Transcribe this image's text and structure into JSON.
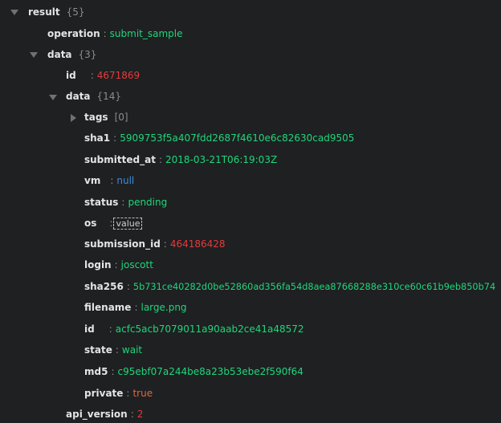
{
  "result": {
    "key": "result",
    "count": "{5}",
    "operation": {
      "key": "operation",
      "value": "submit_sample"
    },
    "data": {
      "key": "data",
      "count": "{3}",
      "id": {
        "key": "id",
        "value": "4671869"
      },
      "data": {
        "key": "data",
        "count": "{14}",
        "tags": {
          "key": "tags",
          "count": "[0]"
        },
        "sha1": {
          "key": "sha1",
          "value": "5909753f5a407fdd2687f4610e6c82630cad9505"
        },
        "submitted_at": {
          "key": "submitted_at",
          "value": "2018-03-21T06:19:03Z"
        },
        "vm": {
          "key": "vm",
          "value": "null"
        },
        "status": {
          "key": "status",
          "value": "pending"
        },
        "os": {
          "key": "os",
          "value": "value"
        },
        "submission_id": {
          "key": "submission_id",
          "value": "464186428"
        },
        "login": {
          "key": "login",
          "value": "joscott"
        },
        "sha256": {
          "key": "sha256",
          "value": "5b731ce40282d0be52860ad356fa54d8aea87668288e310ce60c61b9eb850b74"
        },
        "filename": {
          "key": "filename",
          "value": "large.png"
        },
        "id": {
          "key": "id",
          "value": "acfc5acb7079011a90aab2ce41a48572"
        },
        "state": {
          "key": "state",
          "value": "wait"
        },
        "md5": {
          "key": "md5",
          "value": "c95ebf07a244be8a23b53ebe2f590f64"
        },
        "private": {
          "key": "private",
          "value": "true"
        }
      }
    },
    "api_version": {
      "key": "api_version",
      "value": "2"
    }
  },
  "separator": ":",
  "colors": {
    "string": "#1fd67a",
    "number": "#e63a3c",
    "null": "#3b8ddb",
    "boolean": "#e2683a",
    "background": "#1e2022"
  }
}
